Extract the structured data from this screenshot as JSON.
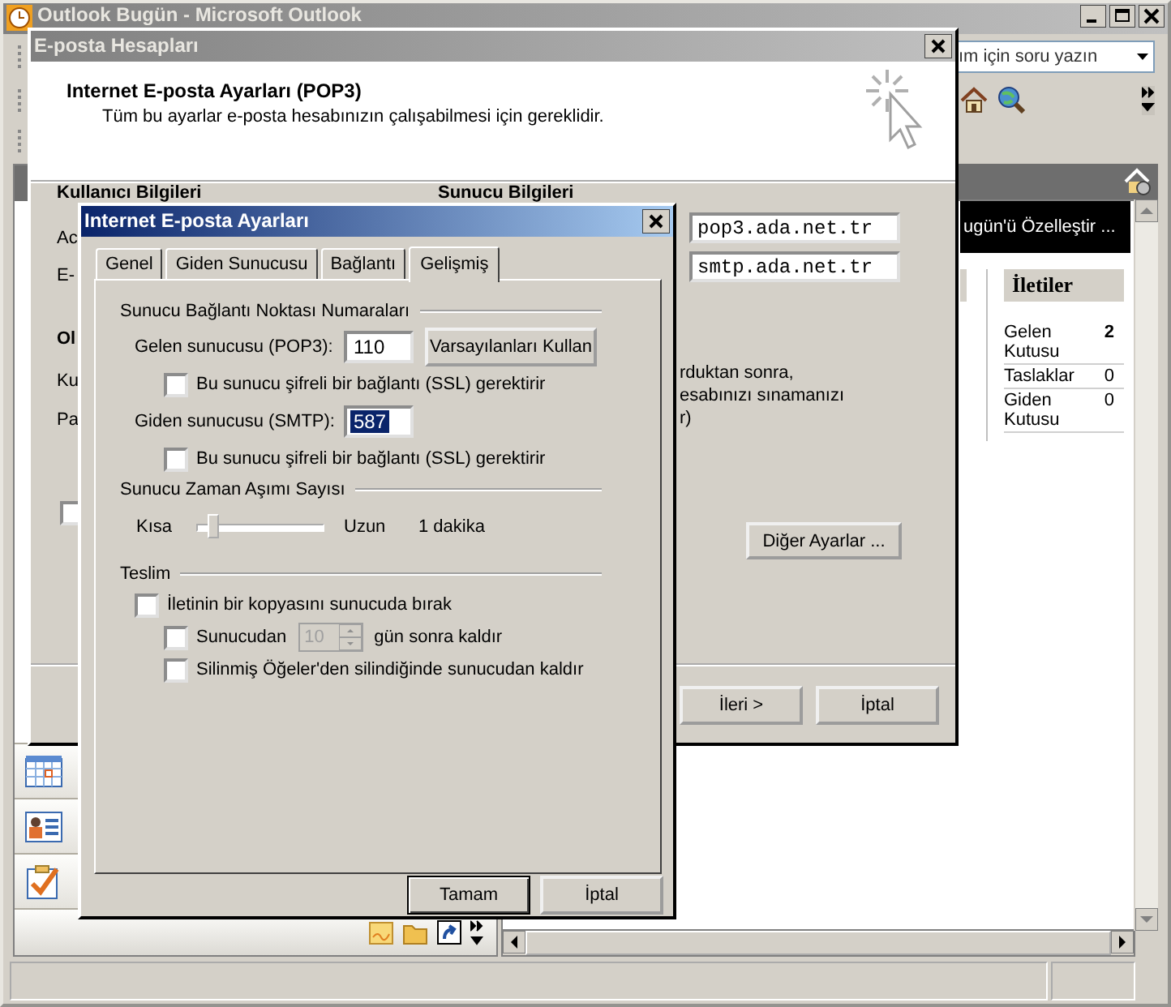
{
  "outlook_window": {
    "title": "Outlook Bugün - Microsoft Outlook",
    "help_box": {
      "placeholder": "ım için soru yazın"
    },
    "customize_bar": "ugün'ü Özelleştir ...",
    "messages": {
      "heading": "İletiler",
      "rows": [
        {
          "name": "Gelen Kutusu",
          "count": "2",
          "unread": true
        },
        {
          "name": "Taslaklar",
          "count": "0",
          "unread": false
        },
        {
          "name": "Giden Kutusu",
          "count": "0",
          "unread": false
        }
      ]
    },
    "nav_buttons": [
      {
        "kind": "calendar"
      },
      {
        "kind": "contacts"
      },
      {
        "kind": "tasks"
      }
    ]
  },
  "accounts_dialog": {
    "title": "E-posta Hesapları",
    "heading": "Internet E-posta Ayarları (POP3)",
    "subheading": "Tüm bu ayarlar e-posta hesabınızın çalışabilmesi için gereklidir.",
    "sections": [
      "Kullanıcı Bilgileri",
      "Sunucu Bilgileri"
    ],
    "labels": [
      {
        "text": "Ac",
        "bold": false
      },
      {
        "text": "E-",
        "bold": false
      },
      {
        "text": "Ol",
        "bold": true
      },
      {
        "text": "Ku",
        "bold": false
      },
      {
        "text": "Pa",
        "bold": false
      }
    ],
    "server_fields": [
      "pop3.ada.net.tr",
      "smtp.ada.net.tr"
    ],
    "test_checkbox": {
      "checked": false
    },
    "note_lines": [
      "rduktan sonra,",
      "esabınızı sınamanızı",
      "r)"
    ],
    "more_button": "Diğer Ayarlar ...",
    "buttons": [
      "İleri >",
      "İptal"
    ]
  },
  "settings_dialog": {
    "title": "Internet E-posta Ayarları",
    "tabs": [
      {
        "label": "Genel",
        "selected": false
      },
      {
        "label": "Giden Sunucusu",
        "selected": false
      },
      {
        "label": "Bağlantı",
        "selected": false
      },
      {
        "label": "Gelişmiş",
        "selected": true
      }
    ],
    "ports": {
      "heading": "Sunucu Bağlantı Noktası Numaraları",
      "incoming": {
        "label": "Gelen sunucusu (POP3):",
        "value": "110",
        "selected": false
      },
      "defaults_button": "Varsayılanları Kullan",
      "incoming_ssl": {
        "label": "Bu sunucu şifreli bir bağlantı (SSL) gerektirir",
        "checked": false
      },
      "outgoing": {
        "label": "Giden sunucusu (SMTP):",
        "value": "587",
        "selected": true
      },
      "outgoing_ssl": {
        "label": "Bu sunucu şifreli bir bağlantı (SSL) gerektirir",
        "checked": false
      }
    },
    "timeout": {
      "heading": "Sunucu Zaman Aşımı Sayısı",
      "min_label": "Kısa",
      "max_label": "Uzun",
      "level": 0.1,
      "reading": "1 dakika"
    },
    "delivery": {
      "heading": "Teslim",
      "leave_copy": {
        "label": "İletinin bir kopyasını sunucuda bırak",
        "checked": false
      },
      "remove_after": {
        "label": "Sunucudan",
        "checked": false,
        "days": "10",
        "days_disabled": true,
        "suffix": "gün sonra kaldır"
      },
      "remove_deleted": {
        "label": "Silinmiş Öğeler'den silindiğinde sunucudan kaldır",
        "checked": false
      }
    },
    "buttons": [
      {
        "label": "Tamam",
        "default": true
      },
      {
        "label": "İptal",
        "default": false
      }
    ]
  }
}
